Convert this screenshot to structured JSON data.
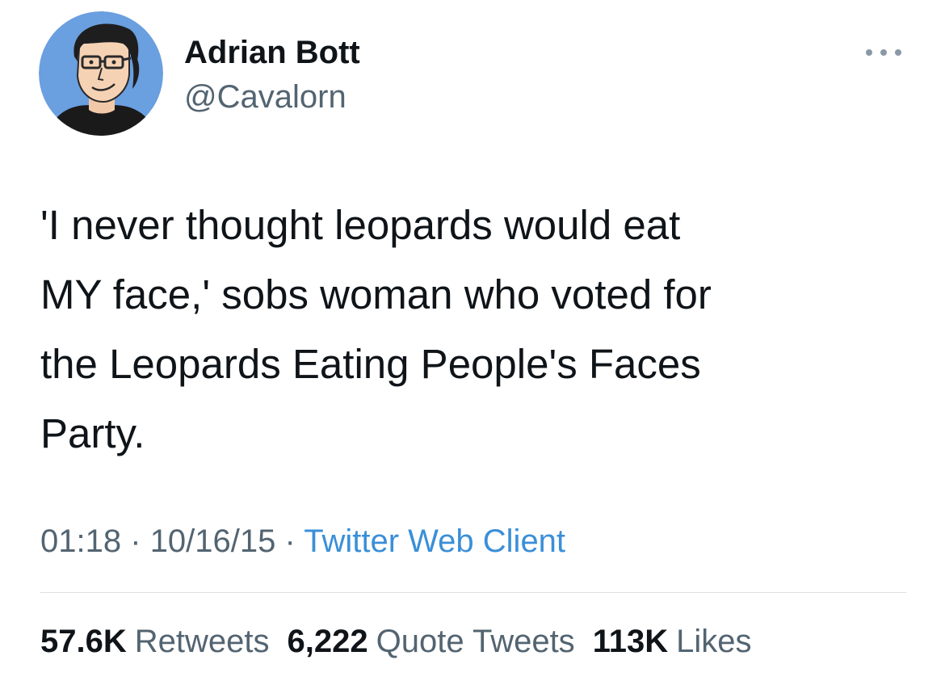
{
  "author": {
    "display_name": "Adrian Bott",
    "handle": "@Cavalorn"
  },
  "tweet": {
    "text": "'I never thought leopards would eat\nMY face,' sobs woman who voted for\nthe Leopards Eating People's Faces\nParty."
  },
  "meta": {
    "time": "01:18",
    "sep1": "·",
    "date": "10/16/15",
    "sep2": "·",
    "source": "Twitter Web Client"
  },
  "stats": {
    "retweets_count": "57.6K",
    "retweets_label": "Retweets",
    "quotes_count": "6,222",
    "quotes_label": "Quote Tweets",
    "likes_count": "113K",
    "likes_label": "Likes"
  },
  "icons": {
    "more": "more-options-icon",
    "avatar": "cartoon-portrait-avatar"
  },
  "colors": {
    "text": "#0f1419",
    "secondary": "#536471",
    "link": "#3a8fd8",
    "avatar_bg": "#6a9fe0",
    "divider": "#dcdfe3"
  }
}
